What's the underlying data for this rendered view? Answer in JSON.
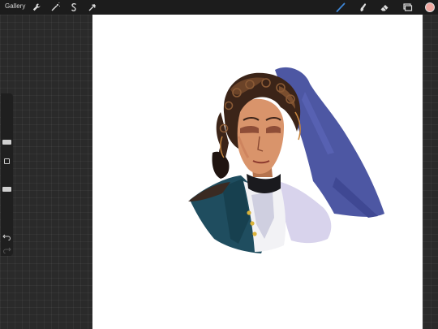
{
  "topbar": {
    "gallery_label": "Gallery",
    "left_tools": [
      "wrench-icon",
      "magic-wand-icon",
      "selection-icon",
      "transform-arrow-icon"
    ],
    "right_tools": [
      "brush-icon",
      "smudge-icon",
      "eraser-icon",
      "layers-icon"
    ],
    "active_tool": "brush-icon",
    "accent_color": "#3e86d6",
    "current_color": "#f0a8a0"
  },
  "sidebar": {
    "brush_size_slider": "slider",
    "opacity_slider": "slider",
    "modify_button": "square",
    "undo_icon": "undo-icon",
    "redo_icon": "redo-icon"
  },
  "canvas": {
    "background": "#ffffff",
    "artwork": "portrait-painting"
  }
}
